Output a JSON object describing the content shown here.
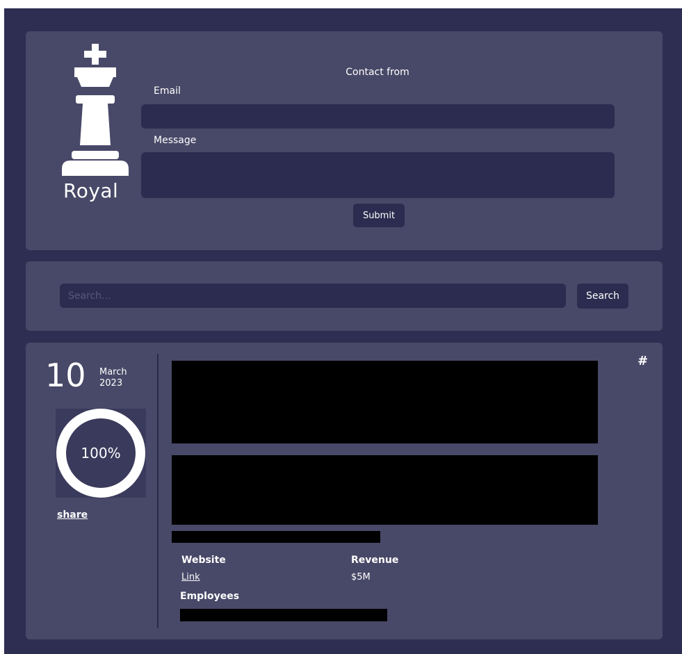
{
  "brand": {
    "name": "Royal",
    "logo_icon": "chess-king-icon"
  },
  "contact_form": {
    "title": "Contact from",
    "email_label": "Email",
    "email_value": "",
    "message_label": "Message",
    "message_value": "",
    "submit_label": "Submit"
  },
  "search": {
    "placeholder": "Search...",
    "value": "",
    "button_label": "Search"
  },
  "entry": {
    "day": "10",
    "month": "March",
    "year": "2023",
    "progress": 100,
    "progress_label": "100%",
    "share_label": "share",
    "hash_icon": "#",
    "website_label": "Website",
    "website_link": "Link",
    "revenue_label": "Revenue",
    "revenue_value": "$5M",
    "employees_label": "Employees"
  },
  "colors": {
    "background": "#2e2e52",
    "card": "#484868",
    "field": "#2c2c50",
    "text": "#ffffff",
    "redacted": "#000000"
  }
}
